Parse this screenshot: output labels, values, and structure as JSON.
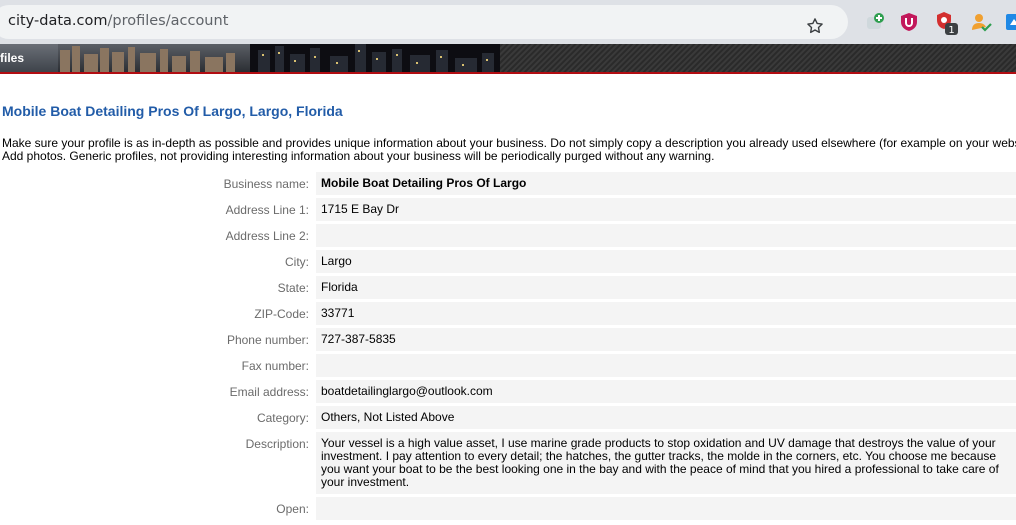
{
  "browser": {
    "url_domain": "city-data.com",
    "url_path": "/profiles/account",
    "extension_badge": "1"
  },
  "banner": {
    "section_label": "files"
  },
  "page": {
    "title": "Mobile Boat Detailing Pros Of Largo, Largo, Florida",
    "intro_line1": "Make sure your profile is as in-depth as possible and provides unique information about your business. Do not simply copy a description you already used elsewhere (for example on your webs",
    "intro_line2": "Add photos. Generic profiles, not providing interesting information about your business will be periodically purged without any warning."
  },
  "form": {
    "fields": [
      {
        "label": "Business name:",
        "value": "Mobile Boat Detailing Pros Of Largo"
      },
      {
        "label": "Address Line 1:",
        "value": "1715 E Bay Dr"
      },
      {
        "label": "Address Line 2:",
        "value": ""
      },
      {
        "label": "City:",
        "value": "Largo"
      },
      {
        "label": "State:",
        "value": "Florida"
      },
      {
        "label": "ZIP-Code:",
        "value": "33771"
      },
      {
        "label": "Phone number:",
        "value": "727-387-5835"
      },
      {
        "label": "Fax number:",
        "value": ""
      },
      {
        "label": "Email address:",
        "value": "boatdetailinglargo@outlook.com"
      },
      {
        "label": "Category:",
        "value": "Others, Not Listed Above"
      },
      {
        "label": "Description:",
        "value": "Your vessel is a high value asset, I use marine grade products to stop oxidation and UV damage that destroys the value of your investment. I pay attention to every detail; the hatches, the gutter tracks, the molde in the corners, etc. You choose me because you want your boat to be the best looking one in the bay and with the peace of mind that you hired a professional to take care of your investment."
      },
      {
        "label": "Open:",
        "value": ""
      }
    ]
  },
  "colors": {
    "title": "#225ca8",
    "banner_border": "#b10d12",
    "row_bg": "#f4f4f4",
    "label": "#6b6b6b"
  },
  "icons": [
    "star-icon",
    "extension-plus-icon",
    "ublock-icon",
    "shield-badge-icon",
    "person-check-icon",
    "blue-square-icon"
  ]
}
